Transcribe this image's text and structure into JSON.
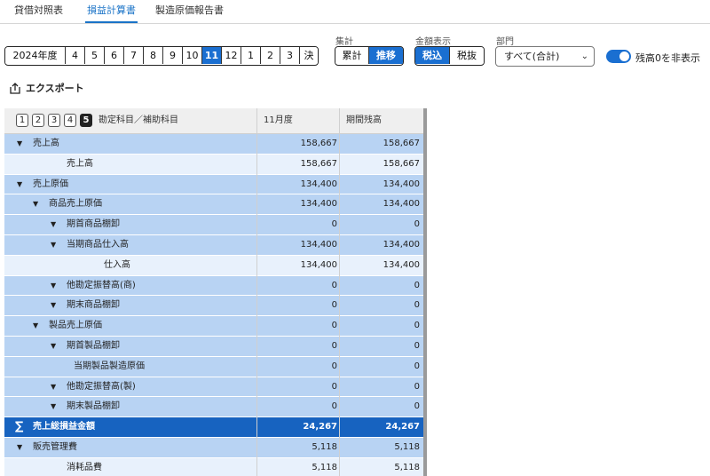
{
  "tabs": [
    {
      "label": "貸借対照表",
      "active": false
    },
    {
      "label": "損益計算書",
      "active": true
    },
    {
      "label": "製造原価報告書",
      "active": false
    }
  ],
  "periods": {
    "items": [
      "2024年度",
      "4",
      "5",
      "6",
      "7",
      "8",
      "9",
      "10",
      "11",
      "12",
      "1",
      "2",
      "3",
      "決"
    ],
    "selected": "11"
  },
  "aggregation": {
    "label": "集計",
    "options": [
      "累計",
      "推移"
    ],
    "selected": "推移"
  },
  "amount_display": {
    "label": "金額表示",
    "options": [
      "税込",
      "税抜"
    ],
    "selected": "税込"
  },
  "department": {
    "label": "部門",
    "value": "すべて(合計)"
  },
  "hide_zero": {
    "label": "残高0を非表示",
    "on": true
  },
  "export_label": "エクスポート",
  "table": {
    "levels": [
      "1",
      "2",
      "3",
      "4",
      "5"
    ],
    "selected_level": "5",
    "columns": [
      "勘定科目／補助科目",
      "11月度",
      "期間残高"
    ],
    "rows": [
      {
        "name": "売上高",
        "indent": 0,
        "type": "parent",
        "expand": true,
        "v1": "158,667",
        "v2": "158,667"
      },
      {
        "name": "売上高",
        "indent": 2,
        "type": "child",
        "expand": false,
        "v1": "158,667",
        "v2": "158,667"
      },
      {
        "name": "売上原価",
        "indent": 0,
        "type": "parent",
        "expand": true,
        "v1": "134,400",
        "v2": "134,400"
      },
      {
        "name": "商品売上原価",
        "indent": 1,
        "type": "parent",
        "expand": true,
        "v1": "134,400",
        "v2": "134,400"
      },
      {
        "name": "期首商品棚卸",
        "indent": 2,
        "type": "parent",
        "expand": true,
        "v1": "0",
        "v2": "0"
      },
      {
        "name": "当期商品仕入高",
        "indent": 2,
        "type": "parent",
        "expand": true,
        "v1": "134,400",
        "v2": "134,400"
      },
      {
        "name": "仕入高",
        "indent": 4,
        "type": "child",
        "expand": false,
        "v1": "134,400",
        "v2": "134,400"
      },
      {
        "name": "他勘定振替高(商)",
        "indent": 2,
        "type": "parent",
        "expand": true,
        "v1": "0",
        "v2": "0"
      },
      {
        "name": "期末商品棚卸",
        "indent": 2,
        "type": "parent",
        "expand": true,
        "v1": "0",
        "v2": "0"
      },
      {
        "name": "製品売上原価",
        "indent": 1,
        "type": "parent",
        "expand": true,
        "v1": "0",
        "v2": "0"
      },
      {
        "name": "期首製品棚卸",
        "indent": 2,
        "type": "parent",
        "expand": true,
        "v1": "0",
        "v2": "0"
      },
      {
        "name": "当期製品製造原価",
        "indent": 3,
        "type": "parent",
        "expand": false,
        "v1": "0",
        "v2": "0"
      },
      {
        "name": "他勘定振替高(製)",
        "indent": 2,
        "type": "parent",
        "expand": true,
        "v1": "0",
        "v2": "0"
      },
      {
        "name": "期末製品棚卸",
        "indent": 2,
        "type": "parent",
        "expand": true,
        "v1": "0",
        "v2": "0"
      },
      {
        "name": "売上総損益金額",
        "indent": 0,
        "type": "total",
        "expand": false,
        "v1": "24,267",
        "v2": "24,267"
      },
      {
        "name": "販売管理費",
        "indent": 0,
        "type": "parent",
        "expand": true,
        "v1": "5,118",
        "v2": "5,118"
      },
      {
        "name": "消耗品費",
        "indent": 2,
        "type": "child",
        "expand": false,
        "v1": "5,118",
        "v2": "5,118"
      }
    ]
  },
  "colors": {
    "accent": "#1a6fd1",
    "parent_row": "#b8d3f3",
    "child_row": "#e8f1fc",
    "total_row": "#1763c0"
  }
}
